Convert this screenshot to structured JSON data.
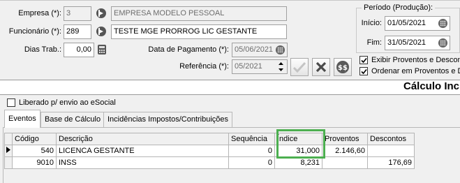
{
  "empresa": {
    "label": "Empresa (*):",
    "code": "3",
    "name": "EMPRESA MODELO PESSOAL"
  },
  "funcionario": {
    "label": "Funcionário (*):",
    "code": "289",
    "name": "TESTE MGE PRORROG LIC GESTANTE"
  },
  "dias_trab": {
    "label": "Dias Trab.:",
    "value": "0,00"
  },
  "data_pagamento": {
    "label": "Data de Pagamento (*):",
    "value": "05/06/2021"
  },
  "referencia": {
    "label": "Referência (*):",
    "value": "05/2021"
  },
  "periodo": {
    "title": "Período (Produção):",
    "inicio_label": "Início:",
    "inicio": "01/05/2021",
    "fim_label": "Fim:",
    "fim": "31/05/2021"
  },
  "options": {
    "exibir": "Exibir Proventos e Descon",
    "ordenar": "Ordenar em Proventos e D"
  },
  "section_title": "Cálculo Inc",
  "esocial_label": "Liberado p/ envio ao eSocial",
  "tabs": [
    "Eventos",
    "Base de Cálculo",
    "Incidências Impostos/Contribuições"
  ],
  "table": {
    "headers": [
      "Código",
      "Descrição",
      "Sequência",
      "Índice",
      "Proventos",
      "Descontos"
    ],
    "rows": [
      {
        "codigo": "540",
        "descricao": "LICENCA GESTANTE",
        "sequencia": "0",
        "indice": "31,000",
        "proventos": "2.146,60",
        "descontos": ""
      },
      {
        "codigo": "9010",
        "descricao": "INSS",
        "sequencia": "0",
        "indice": "8,231",
        "proventos": "",
        "descontos": "176,69"
      }
    ]
  },
  "colors": {
    "highlight": "#4caf50",
    "panel": "#f0f0f0"
  }
}
